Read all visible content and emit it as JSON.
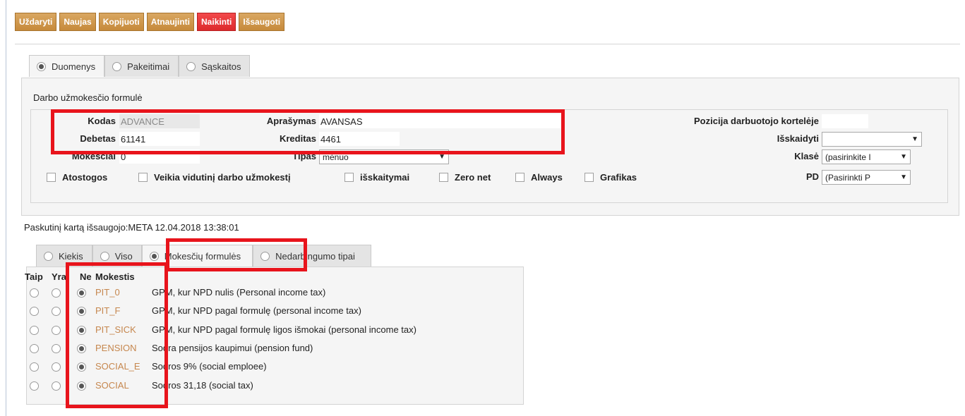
{
  "toolbar": {
    "buttons": [
      {
        "label": "Uždaryti",
        "danger": false
      },
      {
        "label": "Naujas",
        "danger": false
      },
      {
        "label": "Kopijuoti",
        "danger": false
      },
      {
        "label": "Atnaujinti",
        "danger": false
      },
      {
        "label": "Naikinti",
        "danger": true
      },
      {
        "label": "Išsaugoti",
        "danger": false
      }
    ]
  },
  "main_tabs": [
    {
      "label": "Duomenys",
      "selected": true
    },
    {
      "label": "Pakeitimai",
      "selected": false
    },
    {
      "label": "Sąskaitos",
      "selected": false
    }
  ],
  "form": {
    "legend": "Darbo užmokesčio formulė",
    "kodas": {
      "label": "Kodas",
      "value": "ADVANCE"
    },
    "aprasymas": {
      "label": "Aprašymas",
      "value": "AVANSAS"
    },
    "debetas": {
      "label": "Debetas",
      "value": "61141"
    },
    "kreditas": {
      "label": "Kreditas",
      "value": "4461"
    },
    "mokesciai": {
      "label": "Mokesčiai",
      "value": "0"
    },
    "tipas": {
      "label": "Tipas",
      "value": "mėnuo"
    },
    "pozicija": {
      "label": "Pozicija darbuotojo kortelėje",
      "value": ""
    },
    "isskaidyti": {
      "label": "Išskaidyti",
      "value": ""
    },
    "klase": {
      "label": "Klasė",
      "value": "(pasirinkite I"
    },
    "pd": {
      "label": "PD",
      "value": "(Pasirinkti P"
    },
    "checkboxes": [
      {
        "label": "Atostogos",
        "checked": false
      },
      {
        "label": "Veikia vidutinį darbo užmokestį",
        "checked": false
      },
      {
        "label": "išskaitymai",
        "checked": false
      },
      {
        "label": "Zero net",
        "checked": false
      },
      {
        "label": "Always",
        "checked": false
      },
      {
        "label": "Grafikas",
        "checked": false
      }
    ]
  },
  "saved_text": "Paskutinį kartą išsaugojo:META 12.04.2018 13:38:01",
  "sub_tabs": [
    {
      "label": "Kiekis",
      "selected": false
    },
    {
      "label": "Viso",
      "selected": false
    },
    {
      "label": "Mokesčių formulės",
      "selected": true
    },
    {
      "label": "Nedarbingumo tipai",
      "selected": false
    }
  ],
  "tax_table": {
    "headers": {
      "taip": "Taip",
      "yra": "Yra",
      "ne": "Ne",
      "mokestis": "Mokestis"
    },
    "rows": [
      {
        "code": "PIT_0",
        "description": "GPM, kur NPD nulis (Personal income tax)",
        "choice": "ne"
      },
      {
        "code": "PIT_F",
        "description": "GPM, kur NPD pagal formulę (personal income tax)",
        "choice": "ne"
      },
      {
        "code": "PIT_SICK",
        "description": "GPM, kur NPD pagal formulę ligos išmokai (personal income tax)",
        "choice": "ne"
      },
      {
        "code": "PENSION",
        "description": "Sodra pensijos kaupimui (pension fund)",
        "choice": "ne"
      },
      {
        "code": "SOCIAL_E",
        "description": "Sodros 9% (social emploee)",
        "choice": "ne"
      },
      {
        "code": "SOCIAL",
        "description": "Sodros 31,18 (social tax)",
        "choice": "ne"
      }
    ]
  },
  "colors": {
    "button": "#c98f40",
    "danger": "#e8343a",
    "highlight": "#e8141c",
    "code_text": "#c6874e"
  }
}
